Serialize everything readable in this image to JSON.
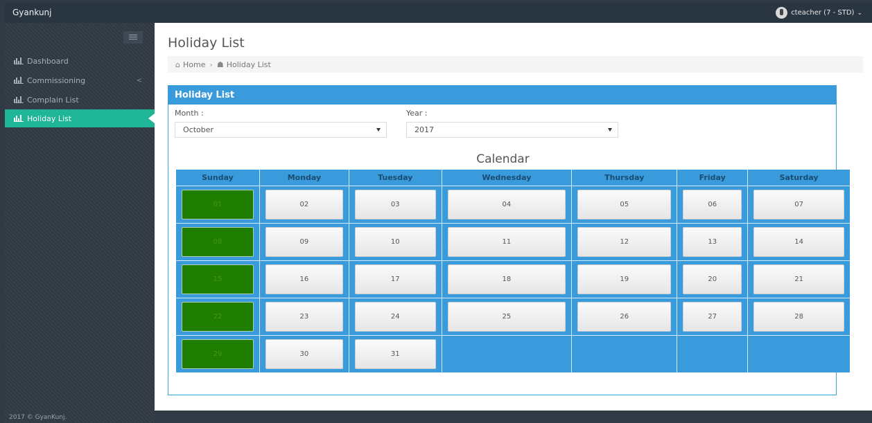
{
  "app": {
    "brand": "Gyankunj"
  },
  "user": {
    "name": "cteacher (7 - STD)"
  },
  "sidebar": {
    "items": [
      {
        "label": "Dashboard",
        "has_submenu": false,
        "active": false
      },
      {
        "label": "Commissioning",
        "has_submenu": true,
        "active": false
      },
      {
        "label": "Complain List",
        "has_submenu": false,
        "active": false
      },
      {
        "label": "Holiday List",
        "has_submenu": false,
        "active": true
      }
    ],
    "footer": "2017 © GyanKunj."
  },
  "page": {
    "title": "Holiday List",
    "breadcrumb": {
      "home": "Home",
      "current": "Holiday List"
    }
  },
  "panel": {
    "heading": "Holiday List",
    "month_label": "Month :",
    "month_value": "October",
    "year_label": "Year :",
    "year_value": "2017",
    "calendar_title": "Calendar"
  },
  "calendar": {
    "weekdays": [
      "Sunday",
      "Monday",
      "Tuesday",
      "Wednesday",
      "Thursday",
      "Friday",
      "Saturday"
    ],
    "weeks": [
      [
        "01",
        "02",
        "03",
        "04",
        "05",
        "06",
        "07"
      ],
      [
        "08",
        "09",
        "10",
        "11",
        "12",
        "13",
        "14"
      ],
      [
        "15",
        "16",
        "17",
        "18",
        "19",
        "20",
        "21"
      ],
      [
        "22",
        "23",
        "24",
        "25",
        "26",
        "27",
        "28"
      ],
      [
        "29",
        "30",
        "31",
        "",
        "",
        "",
        ""
      ]
    ],
    "holidays": [
      "01",
      "08",
      "15",
      "22",
      "29"
    ],
    "colors": {
      "header": "#3a9bdc",
      "holiday": "#1f7d00",
      "active_nav": "#1fb597"
    }
  }
}
